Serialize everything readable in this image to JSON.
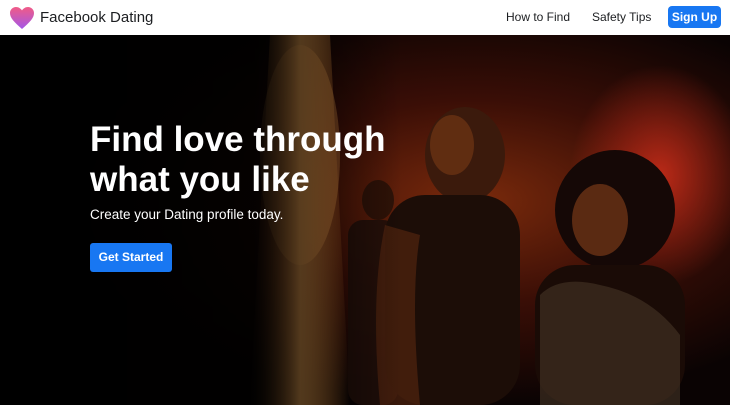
{
  "nav": {
    "brand": "Facebook Dating",
    "links": [
      "How to Find",
      "Safety Tips"
    ],
    "signup": "Sign Up"
  },
  "hero": {
    "headline_line1": "Find love through",
    "headline_line2": "what you like",
    "subheading": "Create your Dating profile today.",
    "cta": "Get Started"
  },
  "colors": {
    "accent": "#1877f2",
    "logo_top": "#e94b91",
    "logo_bottom": "#a357e8"
  },
  "icons": {
    "logo": "heart-icon"
  }
}
